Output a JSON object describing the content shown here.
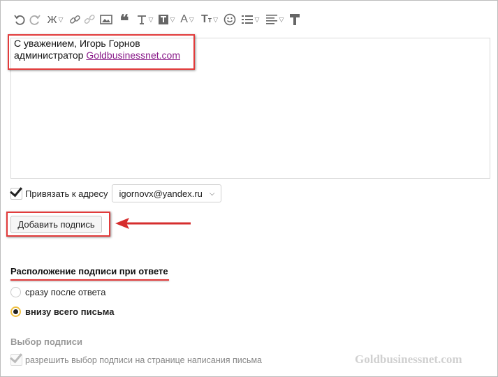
{
  "signature": {
    "line1": "С уважением, Игорь Горнов",
    "line2_prefix": "администратор ",
    "link_text": "Goldbusinessnet.com"
  },
  "toolbar": {
    "icons": [
      "undo-icon",
      "redo-icon",
      "bold-icon",
      "link-icon",
      "unlink-icon",
      "image-icon",
      "quote-icon",
      "text-format-icon",
      "text-box-icon",
      "font-color-icon",
      "font-size-icon",
      "smiley-icon",
      "list-icon",
      "align-icon",
      "format-painter-icon"
    ],
    "bold_label": "Ж"
  },
  "bind_row": {
    "label": "Привязать к адресу",
    "selected_email": "igornovx@yandex.ru",
    "checked": true
  },
  "add_button": {
    "label": "Добавить подпись"
  },
  "placement": {
    "title": "Расположение подписи при ответе",
    "options": [
      {
        "label": "сразу после ответа",
        "selected": false
      },
      {
        "label": "внизу всего письма",
        "selected": true
      }
    ]
  },
  "choice": {
    "title": "Выбор подписи",
    "option_label": "разрешить выбор подписи на странице написания письма",
    "checked": true
  },
  "watermark": "Goldbusinessnet.com",
  "colors": {
    "highlight": "#e23b3b",
    "link": "#8a1c8a",
    "radio_accent": "#f0c040"
  }
}
